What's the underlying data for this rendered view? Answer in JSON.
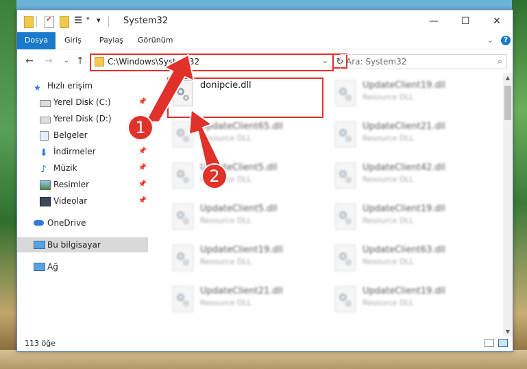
{
  "window": {
    "title": "System32",
    "minimize": "—",
    "maximize": "☐",
    "close": "✕"
  },
  "ribbon": {
    "tabs": [
      "Dosya",
      "Giriş",
      "Paylaş",
      "Görünüm"
    ],
    "collapse": "⌄",
    "help": "?"
  },
  "nav": {
    "back": "←",
    "forward": "→",
    "recent": "⌄",
    "up": "↑",
    "address": "C:\\Windows\\System32",
    "address_dropdown": "⌄",
    "refresh": "↻",
    "search_placeholder": "Ara: System32"
  },
  "sidebar": {
    "items": [
      {
        "label": "Hızlı erişim",
        "icon": "star-icon"
      },
      {
        "label": "Yerel Disk (C:)",
        "icon": "drive-icon",
        "pinned": true
      },
      {
        "label": "Yerel Disk (D:)",
        "icon": "drive-icon"
      },
      {
        "label": "Belgeler",
        "icon": "documents-icon"
      },
      {
        "label": "İndirmeler",
        "icon": "download-icon",
        "pinned": true
      },
      {
        "label": "Müzik",
        "icon": "music-icon",
        "pinned": true
      },
      {
        "label": "Resimler",
        "icon": "pictures-icon",
        "pinned": true
      },
      {
        "label": "Videolar",
        "icon": "videos-icon",
        "pinned": true
      },
      {
        "label": "OneDrive",
        "icon": "cloud-icon"
      },
      {
        "label": "Bu bilgisayar",
        "icon": "computer-icon",
        "selected": true
      },
      {
        "label": "Ağ",
        "icon": "network-icon"
      }
    ]
  },
  "files": [
    {
      "name": "donipcie.dll",
      "desc": ""
    },
    {
      "name": "UpdateClient19.dll",
      "desc": "Resource DLL"
    },
    {
      "name": "UpdateClient65.dll",
      "desc": "Resource DLL"
    },
    {
      "name": "UpdateClient21.dll",
      "desc": "Resource DLL"
    },
    {
      "name": "UpdateClient5.dll",
      "desc": "Resource DLL"
    },
    {
      "name": "UpdateClient42.dll",
      "desc": "Resource DLL"
    },
    {
      "name": "UpdateClient5.dll",
      "desc": "Resource DLL"
    },
    {
      "name": "UpdateClient19.dll",
      "desc": "Resource DLL"
    },
    {
      "name": "UpdateClient19.dll",
      "desc": "Resource DLL"
    },
    {
      "name": "UpdateClient63.dll",
      "desc": "Resource DLL"
    },
    {
      "name": "UpdateClient21.dll",
      "desc": "Resource DLL"
    },
    {
      "name": "UpdateClient19.dll",
      "desc": "Resource DLL"
    }
  ],
  "status": {
    "count": "113 öğe"
  },
  "callouts": [
    "1",
    "2"
  ],
  "colors": {
    "accent": "#1979ca",
    "highlight": "#e0312b"
  }
}
